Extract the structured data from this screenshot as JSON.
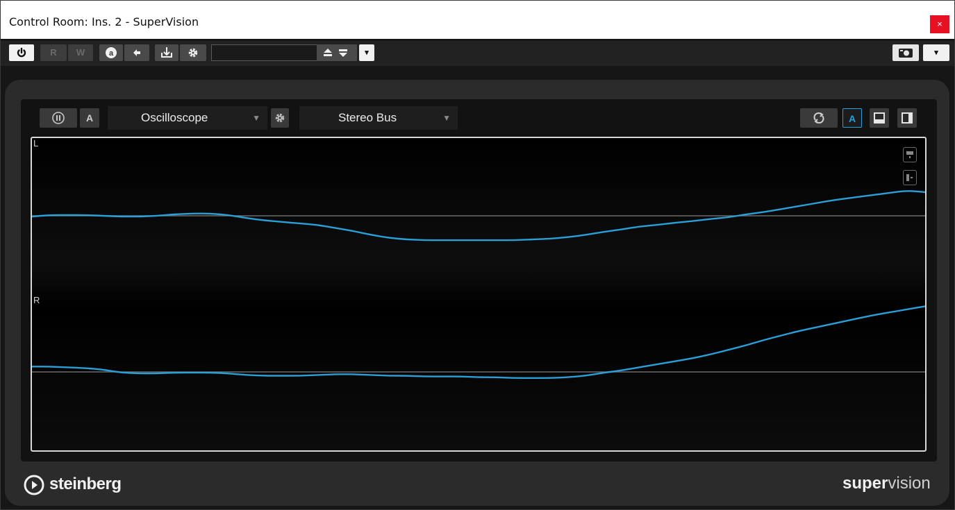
{
  "window": {
    "title": "Control Room: Ins. 2 - SuperVision",
    "close_label": "×"
  },
  "toolbar": {
    "read_label": "R",
    "write_label": "W",
    "preset_name": "",
    "dropdown_arrow": "▾"
  },
  "supervision": {
    "module_name": "Oscilloscope",
    "channel_source": "Stereo Bus",
    "auto_label": "A",
    "auto_scale_label": "A",
    "channel_left_label": "L",
    "channel_right_label": "R"
  },
  "footer": {
    "brand": "steinberg",
    "product_bold": "super",
    "product_light": "vision"
  },
  "colors": {
    "waveform": "#2a9fd8",
    "accent": "#1fa3e0",
    "zero_line": "#6a6a6a"
  },
  "chart_data": {
    "type": "line",
    "title": "",
    "xlabel": "",
    "ylabel": "",
    "grid": false,
    "x": [
      0,
      0.02,
      0.04,
      0.06,
      0.08,
      0.1,
      0.12,
      0.14,
      0.16,
      0.18,
      0.2,
      0.22,
      0.24,
      0.26,
      0.28,
      0.3,
      0.32,
      0.34,
      0.36,
      0.38,
      0.4,
      0.42,
      0.44,
      0.46,
      0.48,
      0.5,
      0.52,
      0.54,
      0.56,
      0.58,
      0.6,
      0.62,
      0.64,
      0.66,
      0.68,
      0.7,
      0.72,
      0.74,
      0.76,
      0.78,
      0.8,
      0.82,
      0.84,
      0.86,
      0.88,
      0.9,
      0.92,
      0.94,
      0.96,
      0.98,
      1.0
    ],
    "series": [
      {
        "channel": "L",
        "values": [
          -0.01,
          0.01,
          0.01,
          0.01,
          0.0,
          -0.01,
          -0.01,
          0.0,
          0.02,
          0.03,
          0.03,
          0.01,
          -0.03,
          -0.06,
          -0.08,
          -0.1,
          -0.12,
          -0.16,
          -0.2,
          -0.25,
          -0.29,
          -0.31,
          -0.32,
          -0.32,
          -0.32,
          -0.32,
          -0.32,
          -0.32,
          -0.31,
          -0.3,
          -0.28,
          -0.25,
          -0.21,
          -0.18,
          -0.14,
          -0.12,
          -0.09,
          -0.07,
          -0.04,
          -0.02,
          0.02,
          0.05,
          0.09,
          0.13,
          0.17,
          0.21,
          0.24,
          0.27,
          0.3,
          0.33,
          0.31
        ]
      },
      {
        "channel": "R",
        "values": [
          0.07,
          0.07,
          0.06,
          0.05,
          0.03,
          -0.01,
          -0.02,
          -0.02,
          -0.01,
          -0.01,
          -0.01,
          -0.02,
          -0.04,
          -0.05,
          -0.05,
          -0.05,
          -0.04,
          -0.03,
          -0.03,
          -0.04,
          -0.05,
          -0.05,
          -0.06,
          -0.06,
          -0.06,
          -0.07,
          -0.07,
          -0.08,
          -0.08,
          -0.08,
          -0.07,
          -0.05,
          -0.01,
          0.02,
          0.06,
          0.1,
          0.14,
          0.18,
          0.23,
          0.29,
          0.35,
          0.42,
          0.48,
          0.54,
          0.59,
          0.64,
          0.69,
          0.74,
          0.78,
          0.82,
          0.86
        ]
      }
    ]
  }
}
